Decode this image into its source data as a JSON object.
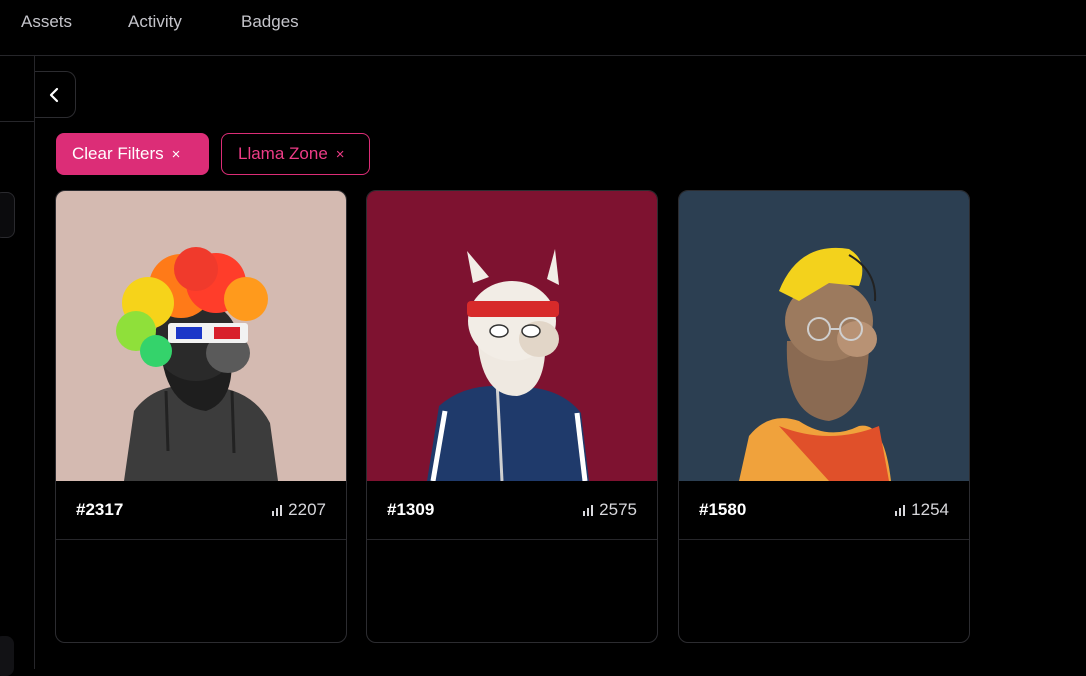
{
  "nav": {
    "tabs": [
      {
        "label": "Assets"
      },
      {
        "label": "Activity"
      },
      {
        "label": "Badges"
      }
    ]
  },
  "filters": {
    "clear_label": "Clear Filters",
    "active_label": "Llama Zone",
    "remove_glyph": "×"
  },
  "colors": {
    "accent": "#dc2d77",
    "background": "#000000"
  },
  "cards": [
    {
      "id": "#2317",
      "rank": "2207",
      "bg": "#d4bab1",
      "icon": "rank-bars-icon"
    },
    {
      "id": "#1309",
      "rank": "2575",
      "bg": "#7e1230",
      "icon": "rank-bars-icon"
    },
    {
      "id": "#1580",
      "rank": "1254",
      "bg": "#2c3f52",
      "icon": "rank-bars-icon"
    }
  ],
  "icons": {
    "back": "chevron-left-icon",
    "rank": "rank-bars-icon"
  }
}
